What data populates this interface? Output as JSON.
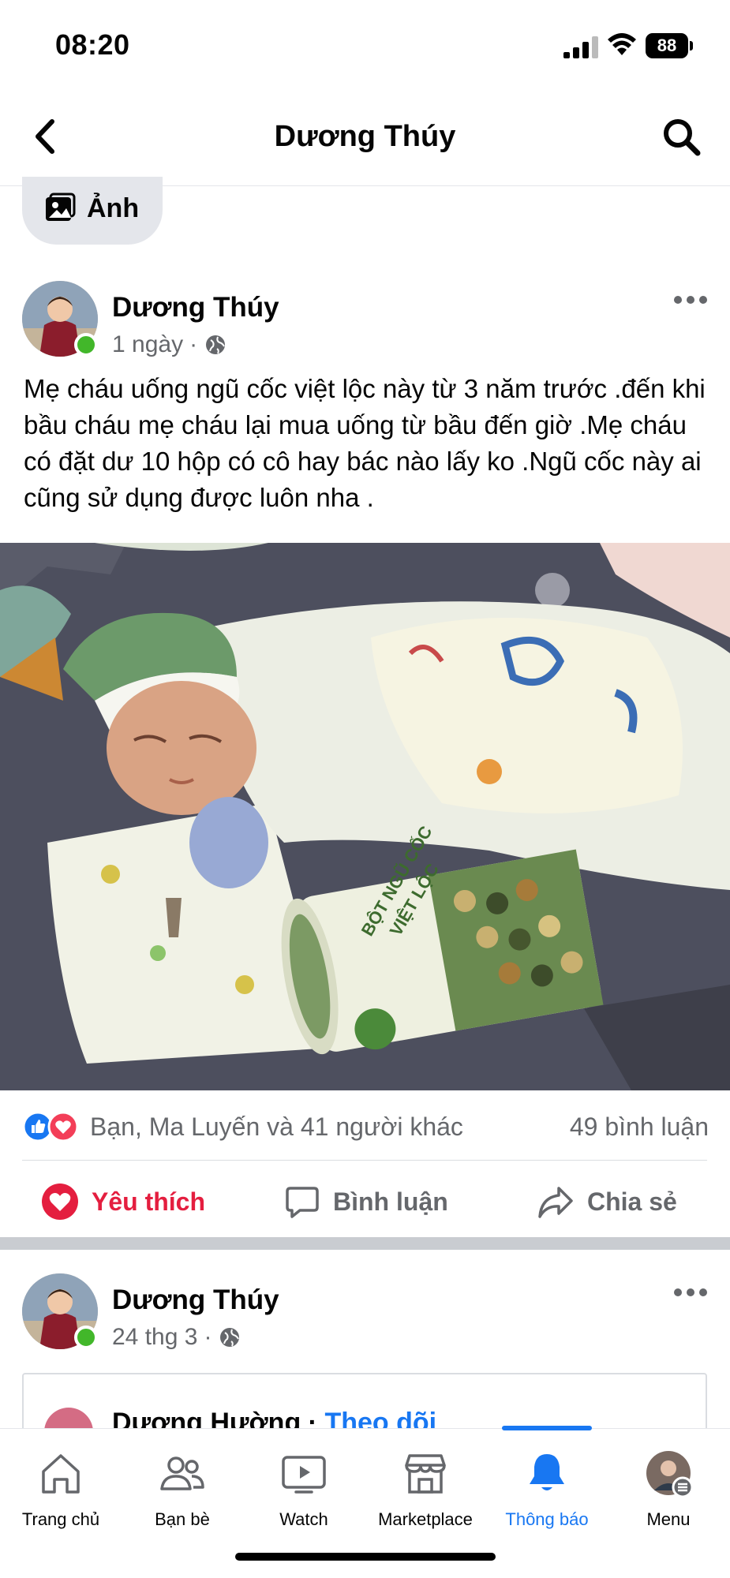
{
  "status_bar": {
    "time": "08:20",
    "battery": "88"
  },
  "header": {
    "title": "Dương Thúy"
  },
  "photo_chip": {
    "label": "Ảnh"
  },
  "post": {
    "author": "Dương Thúy",
    "time": "1 ngày",
    "text": "Mẹ cháu uống ngũ cốc việt lộc này từ 3 năm trước .đến khi bầu cháu mẹ cháu lại mua uống từ bầu đến giờ .Mẹ cháu có đặt dư 10 hộp có cô hay bác nào lấy ko .Ngũ cốc này ai cũng sử dụng được luôn nha .",
    "product_label_line1": "BỘT NGŨ CỐC",
    "product_label_line2": "VIỆT LỘC",
    "reactions_text": "Bạn, Ma Luyến và 41 người khác",
    "comments_text": "49 bình luận",
    "actions": {
      "like": "Yêu thích",
      "comment": "Bình luận",
      "share": "Chia sẻ"
    }
  },
  "post2": {
    "author": "Dương Thúy",
    "time": "24 thg 3",
    "shared_author": "Dương Hường",
    "follow": "Theo dõi"
  },
  "bottom_nav": {
    "items": [
      {
        "label": "Trang chủ"
      },
      {
        "label": "Bạn bè"
      },
      {
        "label": "Watch"
      },
      {
        "label": "Marketplace"
      },
      {
        "label": "Thông báo"
      },
      {
        "label": "Menu"
      }
    ]
  },
  "colors": {
    "accent": "#1877f2",
    "like": "#e41e3f",
    "online": "#42b72a"
  }
}
